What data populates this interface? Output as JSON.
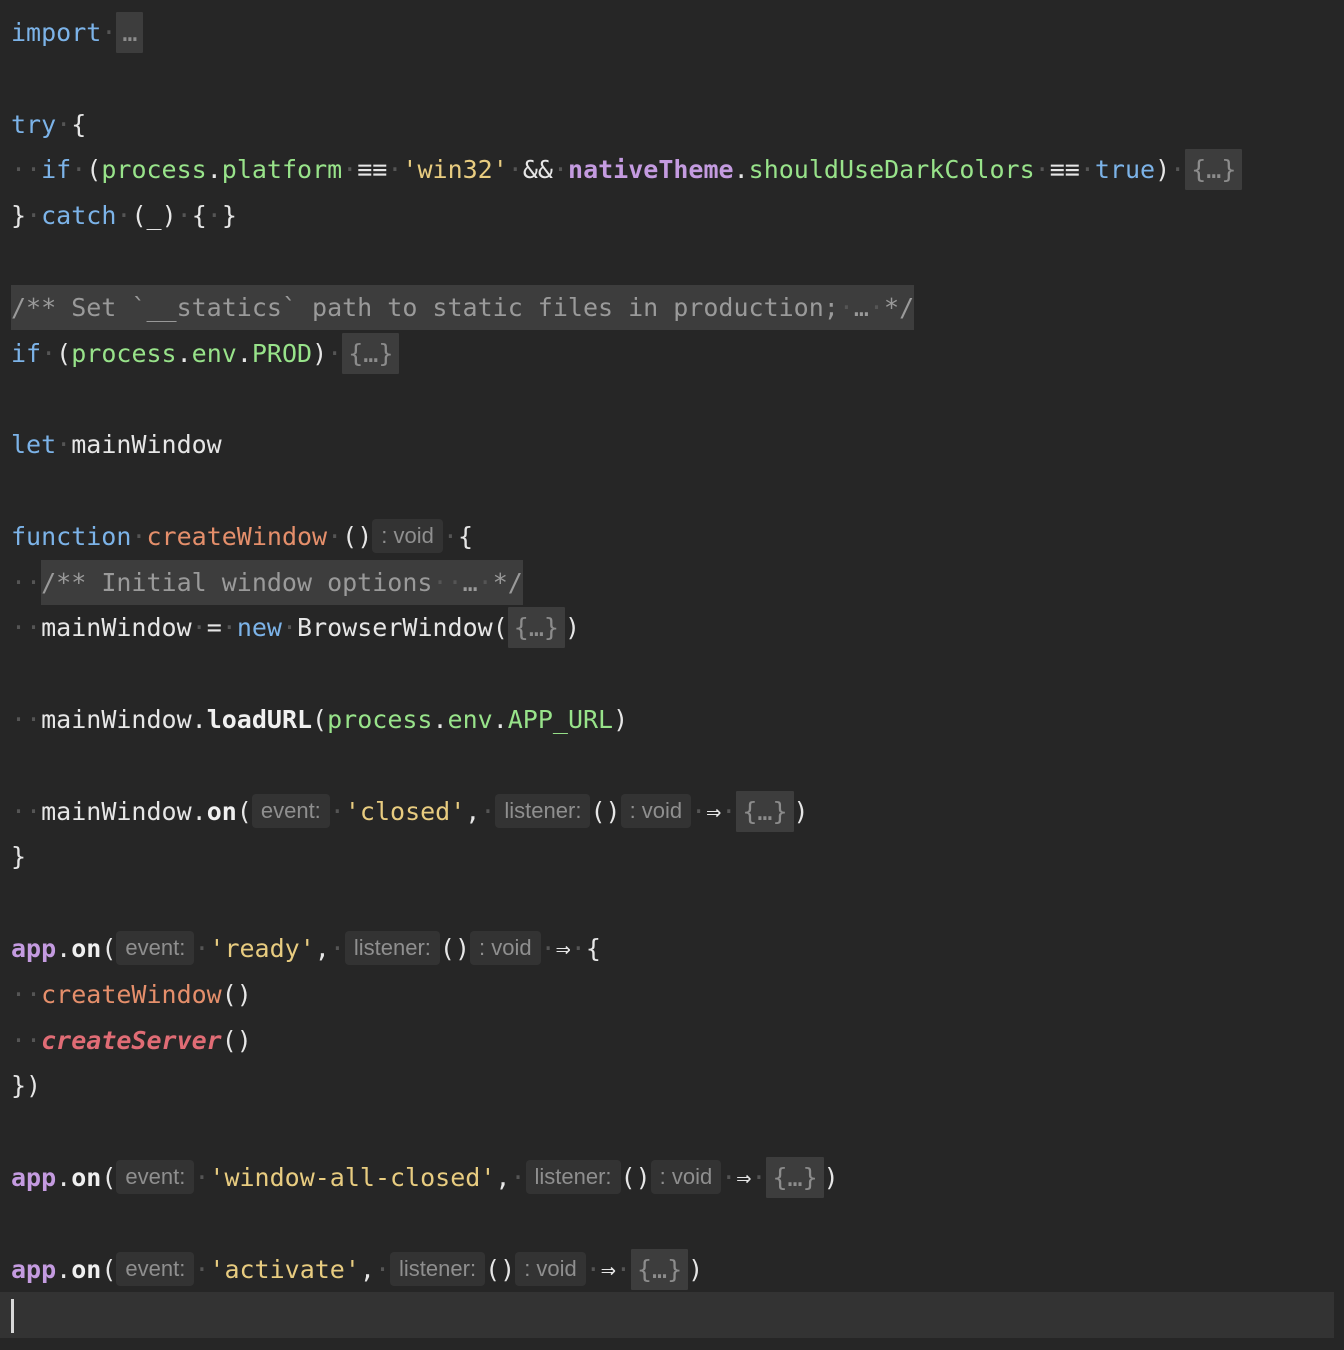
{
  "editor": {
    "fold_placeholder": "…",
    "hints": {
      "void": ": void",
      "event": "event:",
      "listener": "listener:"
    },
    "code": {
      "kw_import": "import",
      "kw_try": "try",
      "kw_if": "if",
      "kw_catch": "catch",
      "kw_let": "let",
      "kw_function": "function",
      "kw_new": "new",
      "kw_true": "true",
      "process": "process",
      "platform": "platform",
      "env": "env",
      "prod": "PROD",
      "app_url": "APP_URL",
      "win32_str": "'win32'",
      "native_theme": "nativeTheme",
      "should_use_dark": "shouldUseDarkColors",
      "underscore": "_",
      "statics_comment": "/** Set `__statics` path to static files in production;",
      "initial_options_comment": "/** Initial window options",
      "comment_end": "*/",
      "main_window": "mainWindow",
      "create_window": "createWindow",
      "create_server": "createServer",
      "browser_window": "BrowserWindow",
      "load_url": "loadURL",
      "on": "on",
      "app": "app",
      "closed_str": "'closed'",
      "ready_str": "'ready'",
      "window_all_closed_str": "'window-all-closed'",
      "activate_str": "'activate'"
    }
  }
}
